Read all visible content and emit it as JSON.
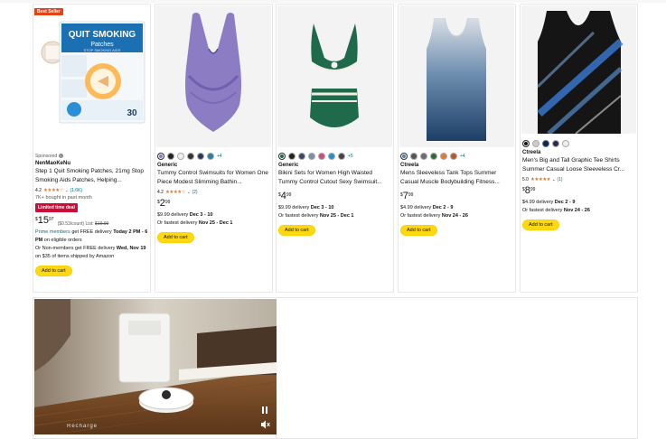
{
  "products": [
    {
      "badge": "Best Seller",
      "sponsored": "Sponsored",
      "brand": "NenMaoKeNu",
      "title": "Step 1 Quit Smoking Patches, 21mg Stop Smoking Aids Patches, Helping...",
      "rating_value": "4.2",
      "rating_count": "(1.6K)",
      "bought": "7K+ bought in past month",
      "deal": "Limited time deal",
      "price_symbol": "$",
      "price_whole": "15",
      "price_fraction": "97",
      "unit_price": "($0.53/count)",
      "list_label": "List:",
      "list_price": "$19.99",
      "delivery_prime": "Prime members",
      "delivery_line1": "get FREE delivery",
      "delivery_day": "Today 2 PM - 6 PM",
      "delivery_line1b": "on eligible orders",
      "delivery_line2": "Or Non-members get FREE delivery",
      "delivery_line2_date": "Wed, Nov 19",
      "delivery_line2b": "on $35 of items shipped by Amazon",
      "add_to_cart": "Add to cart",
      "pkg_line1": "QUIT SMOKING",
      "pkg_line2": "Patches",
      "pkg_line3": "STOP SMOKING AIDS",
      "pkg_count": "30"
    },
    {
      "more_swatches": "+4",
      "brand": "Generic",
      "title": "Tummy Control Swimsuits for Women One Piece Modest Slimming Bathin...",
      "rating_value": "4.2",
      "rating_count": "(2)",
      "price_symbol": "$",
      "price_whole": "2",
      "price_fraction": "99",
      "delivery_fee": "$9.99 delivery",
      "delivery_date": "Dec 3 - 10",
      "fastest_label": "Or fastest delivery",
      "fastest_date": "Nov 25 - Dec 1",
      "add_to_cart": "Add to cart"
    },
    {
      "more_swatches": "+5",
      "brand": "Generic",
      "title": "Bikini Sets for Women High Waisted Tummy Control Cutout Sexy Swimsuit...",
      "price_symbol": "$",
      "price_whole": "4",
      "price_fraction": "99",
      "delivery_fee": "$9.99 delivery",
      "delivery_date": "Dec 3 - 10",
      "fastest_label": "Or fastest delivery",
      "fastest_date": "Nov 25 - Dec 1",
      "add_to_cart": "Add to cart"
    },
    {
      "more_swatches": "+4",
      "brand": "Ctreela",
      "title": "Mens Sleeveless Tank Tops Summer Casual Muscle Bodybuilding Fitness...",
      "price_symbol": "$",
      "price_whole": "7",
      "price_fraction": "99",
      "delivery_fee": "$4.99 delivery",
      "delivery_date": "Dec 2 - 9",
      "fastest_label": "Or fastest delivery",
      "fastest_date": "Nov 24 - 26",
      "add_to_cart": "Add to cart"
    },
    {
      "brand": "Ctreela",
      "title": "Men's Big and Tall Graphic Tee Shirts Summer Casual Loose Sleeveless Cr...",
      "rating_value": "5.0",
      "rating_count": "(1)",
      "price_symbol": "$",
      "price_whole": "8",
      "price_fraction": "99",
      "delivery_fee": "$4.99 delivery",
      "delivery_date": "Dec 2 - 9",
      "fastest_label": "Or fastest delivery",
      "fastest_date": "Nov 24 - 26",
      "add_to_cart": "Add to cart"
    }
  ],
  "video": {
    "caption": "Recharge",
    "pause_icon": "pause-icon",
    "mute_icon": "mute-icon"
  },
  "colors": {
    "star": "#de7921",
    "link": "#007185",
    "deal": "#cc0c39",
    "badge": "#e0451a",
    "button": "#ffd814"
  }
}
